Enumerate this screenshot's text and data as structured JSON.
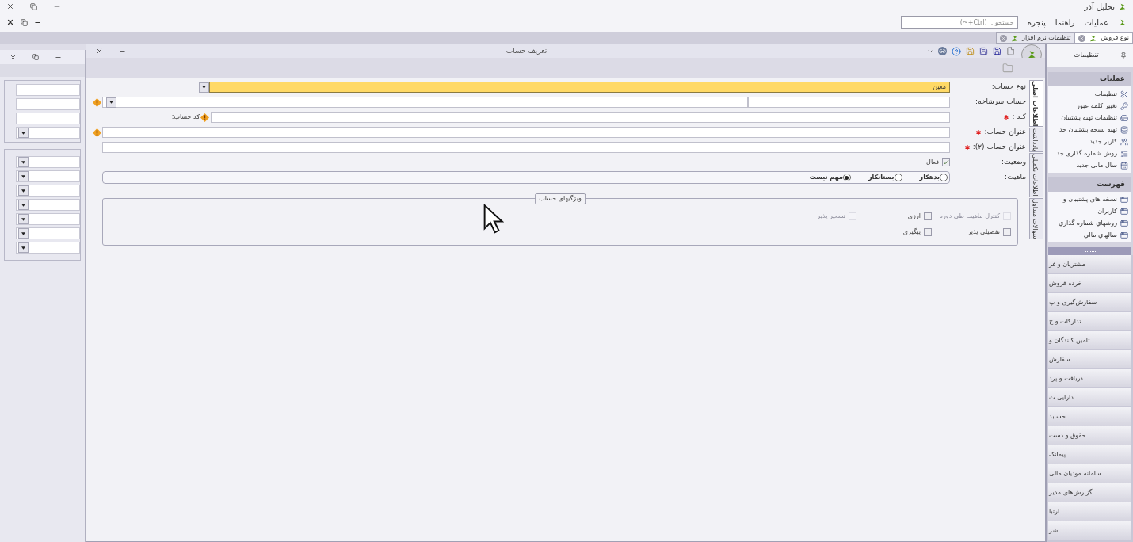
{
  "app": {
    "title": "تحلیل آذر"
  },
  "menu": [
    {
      "label": "عملیات"
    },
    {
      "label": "راهنما"
    },
    {
      "label": "پنجره"
    }
  ],
  "search": {
    "placeholder": "جستجو... (Ctrl+~)"
  },
  "doc_tabs": [
    {
      "label": "نوع فروش",
      "selected": true
    },
    {
      "label": "تنظیمات نرم افزار",
      "selected": false
    }
  ],
  "dialog": {
    "title": "تعریف حساب",
    "side_tabs": [
      {
        "label": "اطلاعات اصلی",
        "selected": true
      },
      {
        "label": "یادداشت",
        "selected": false
      },
      {
        "label": "اطلاعات تکمیلی",
        "selected": false
      },
      {
        "label": "سوالات متداول",
        "selected": false
      }
    ],
    "fields": [
      {
        "kind": "select",
        "label": "نوع حساب:",
        "required": false,
        "warning": false,
        "focused": true,
        "value": "معین"
      },
      {
        "kind": "split-select",
        "label": "حساب سرشاخه:",
        "required": false,
        "warning": true,
        "focused": false
      },
      {
        "kind": "code",
        "label": "کـد :",
        "required": true,
        "warning": true,
        "focused": false,
        "sub_label": "کد حساب:"
      },
      {
        "kind": "text",
        "label": "عنوان حساب:",
        "required": true,
        "warning": true,
        "focused": false
      },
      {
        "kind": "text",
        "label": "عنوان حساب (۲):",
        "required": true,
        "warning": false,
        "focused": false
      },
      {
        "kind": "checkbox",
        "label": "وضعیت:",
        "required": false,
        "option": "فعال",
        "checked": true
      },
      {
        "kind": "radio",
        "label": "ماهیت:",
        "required": false,
        "options": [
          {
            "label": "بدهکار",
            "selected": false
          },
          {
            "label": "بستانکار",
            "selected": false
          },
          {
            "label": "مهم نیست",
            "selected": true
          }
        ]
      }
    ],
    "features": {
      "title": "ویژگیهای حساب",
      "options": [
        {
          "label": "کنترل ماهیت طی دوره",
          "checked": false,
          "disabled": true
        },
        {
          "label": "ارزی",
          "checked": false,
          "disabled": false
        },
        {
          "label": "تسعیر پذیر",
          "checked": false,
          "disabled": true
        },
        {
          "label": "تفصیلی پذیر",
          "checked": false,
          "disabled": false
        },
        {
          "label": "پیگیری",
          "checked": false,
          "disabled": false
        }
      ]
    }
  },
  "sidebar": {
    "title": "تنظیمات",
    "sections": [
      {
        "title": "عملیات",
        "items": [
          {
            "label": "تنظیمات"
          },
          {
            "label": "تغییر کلمه عبور"
          },
          {
            "label": "تنظیمات تهیه پشتیبان"
          },
          {
            "label": "تهیه نسخه پشتیبان جد"
          },
          {
            "label": "کاربر جدید"
          },
          {
            "label": "روش شماره گذاری جد"
          },
          {
            "label": "سال مالی جدید"
          }
        ]
      },
      {
        "title": "فهرست",
        "items": [
          {
            "label": "نسخه های پشتیبان و"
          },
          {
            "label": "کاربران"
          },
          {
            "label": "روشهاي شماره گذاري"
          },
          {
            "label": "سالهاي مالي"
          }
        ]
      }
    ],
    "nav": [
      {
        "label": "مشتریان و فر"
      },
      {
        "label": "خرده فروش"
      },
      {
        "label": "سفارش‌گیری و پ"
      },
      {
        "label": "تدارکات و خ"
      },
      {
        "label": "تامین کنندگان و"
      },
      {
        "label": "سفارش"
      },
      {
        "label": "دریافت و پرد"
      },
      {
        "label": "دارایی ث"
      },
      {
        "label": "حسابد"
      },
      {
        "label": "حقوق و دست"
      },
      {
        "label": "پیمانک"
      },
      {
        "label": "سامانه مودیان مالی"
      },
      {
        "label": "گزارش‌های مدیر"
      },
      {
        "label": "ارتبا"
      },
      {
        "label": "شر"
      }
    ]
  }
}
